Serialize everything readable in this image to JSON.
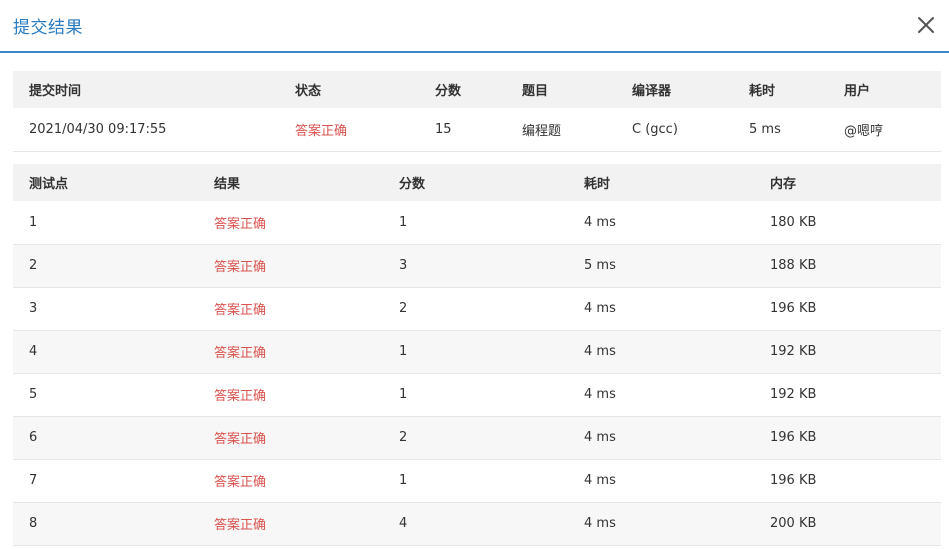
{
  "dialog": {
    "title": "提交结果",
    "close_icon": "close-icon"
  },
  "summary": {
    "headers": [
      "提交时间",
      "状态",
      "分数",
      "题目",
      "编译器",
      "耗时",
      "用户"
    ],
    "row": [
      "2021/04/30 09:17:55",
      "答案正确",
      "15",
      "编程题",
      "C (gcc)",
      "5 ms",
      "@嗯哼"
    ]
  },
  "cases": {
    "headers": [
      "测试点",
      "结果",
      "分数",
      "耗时",
      "内存"
    ],
    "rows": [
      [
        "1",
        "答案正确",
        "1",
        "4 ms",
        "180 KB"
      ],
      [
        "2",
        "答案正确",
        "3",
        "5 ms",
        "188 KB"
      ],
      [
        "3",
        "答案正确",
        "2",
        "4 ms",
        "196 KB"
      ],
      [
        "4",
        "答案正确",
        "1",
        "4 ms",
        "192 KB"
      ],
      [
        "5",
        "答案正确",
        "1",
        "4 ms",
        "192 KB"
      ],
      [
        "6",
        "答案正确",
        "2",
        "4 ms",
        "196 KB"
      ],
      [
        "7",
        "答案正确",
        "1",
        "4 ms",
        "196 KB"
      ],
      [
        "8",
        "答案正确",
        "4",
        "4 ms",
        "200 KB"
      ]
    ]
  },
  "colors": {
    "accent": "#2a7bc0",
    "divider": "#3b86c6",
    "status_ok": "#d9534f",
    "header_bg": "#f2f2f2"
  }
}
